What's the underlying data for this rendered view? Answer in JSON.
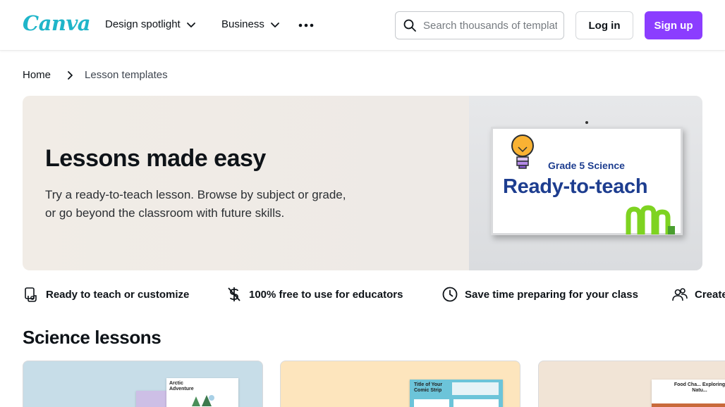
{
  "header": {
    "logo": "Canva",
    "nav": [
      {
        "label": "Design spotlight"
      },
      {
        "label": "Business"
      }
    ],
    "more_icon": "more-dots-icon",
    "search": {
      "placeholder": "Search thousands of templates",
      "icon": "search-icon"
    },
    "login_label": "Log in",
    "signup_label": "Sign up"
  },
  "breadcrumb": {
    "home": "Home",
    "current": "Lesson templates"
  },
  "hero": {
    "title": "Lessons made easy",
    "description": "Try a ready-to-teach lesson. Browse by subject or grade, or go beyond the classroom with future skills.",
    "image": {
      "subtitle": "Grade 5 Science",
      "title": "Ready-to-teach"
    }
  },
  "features": [
    {
      "label": "Ready to teach or customize",
      "icon": "hand-template-icon"
    },
    {
      "label": "100% free to use for educators",
      "icon": "dollar-icon"
    },
    {
      "label": "Save time preparing for your class",
      "icon": "clock-icon"
    },
    {
      "label": "Create",
      "icon": "people-icon"
    }
  ],
  "section": {
    "title": "Science lessons",
    "cards": [
      {
        "preview_text": "Arctic Adventure"
      },
      {
        "preview_text": "Title of Your Comic Strip"
      },
      {
        "preview_text": "Food Cha... Exploring Natu..."
      }
    ]
  },
  "colors": {
    "brand_purple": "#8b3dff",
    "logo_teal": "#1fb5c9",
    "board_text": "#1d3d8f"
  }
}
